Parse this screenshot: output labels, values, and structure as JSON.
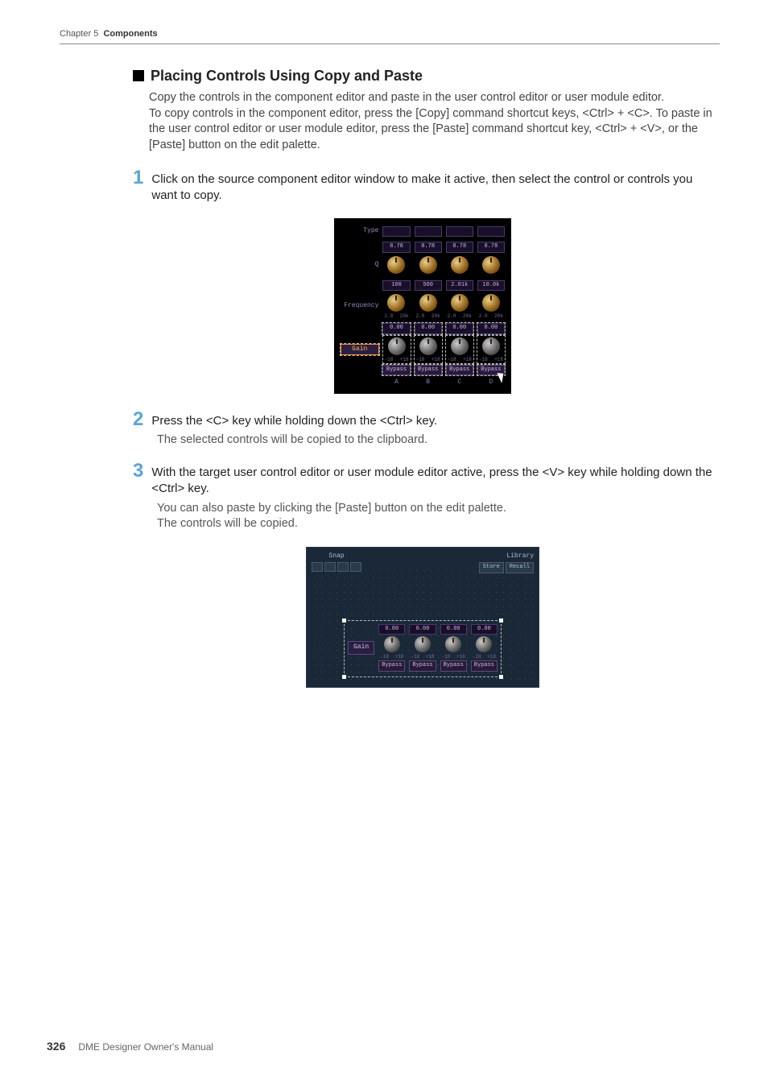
{
  "header": {
    "chapter_label": "Chapter 5",
    "chapter_title": "Components"
  },
  "section": {
    "title": "Placing Controls Using Copy and Paste",
    "intro_p1": "Copy the controls in the component editor and paste in the user control editor or user module editor.",
    "intro_p2": "To copy controls in the component editor, press the [Copy] command shortcut keys, <Ctrl> + <C>. To paste in the user control editor or user module editor, press the [Paste] command shortcut key, <Ctrl> + <V>, or the [Paste] button on the edit palette."
  },
  "steps": [
    {
      "num": "1",
      "title": "Click on the source component editor window to make it active, then select the control or controls you want to copy.",
      "body": ""
    },
    {
      "num": "2",
      "title": "Press the <C> key while holding down the <Ctrl> key.",
      "body": "The selected controls will be copied to the clipboard."
    },
    {
      "num": "3",
      "title": "With the target user control editor or user module editor active, press the <V> key while holding down the <Ctrl> key.",
      "body": "You can also paste by clicking the [Paste] button on the edit palette.\nThe controls will be copied."
    }
  ],
  "fig1": {
    "labels": {
      "type": "Type",
      "q": "Q",
      "frequency": "Frequency",
      "gain": "Gain"
    },
    "q_vals": [
      "8.78",
      "8.78",
      "8.78",
      "8.78"
    ],
    "freq_vals": [
      "100",
      "500",
      "2.01k",
      "10.0k"
    ],
    "freq_ticks_lo": "2.0",
    "freq_ticks_hi": "20k",
    "gain_vals": [
      "0.00",
      "0.00",
      "0.00",
      "0.00"
    ],
    "gain_ticks_lo": "-18",
    "gain_ticks_hi": "+18",
    "bypass": "Bypass",
    "cols": [
      "A",
      "B",
      "C",
      "D"
    ]
  },
  "fig2": {
    "snap": "Snap",
    "library": "Library",
    "store": "Store",
    "recall": "Recall",
    "gain": "Gain",
    "gain_vals": [
      "0.00",
      "0.00",
      "0.00",
      "0.00"
    ],
    "ticks_lo": "-18",
    "ticks_hi": "+18",
    "bypass": "Bypass"
  },
  "footer": {
    "page": "326",
    "manual": "DME Designer Owner's Manual"
  }
}
